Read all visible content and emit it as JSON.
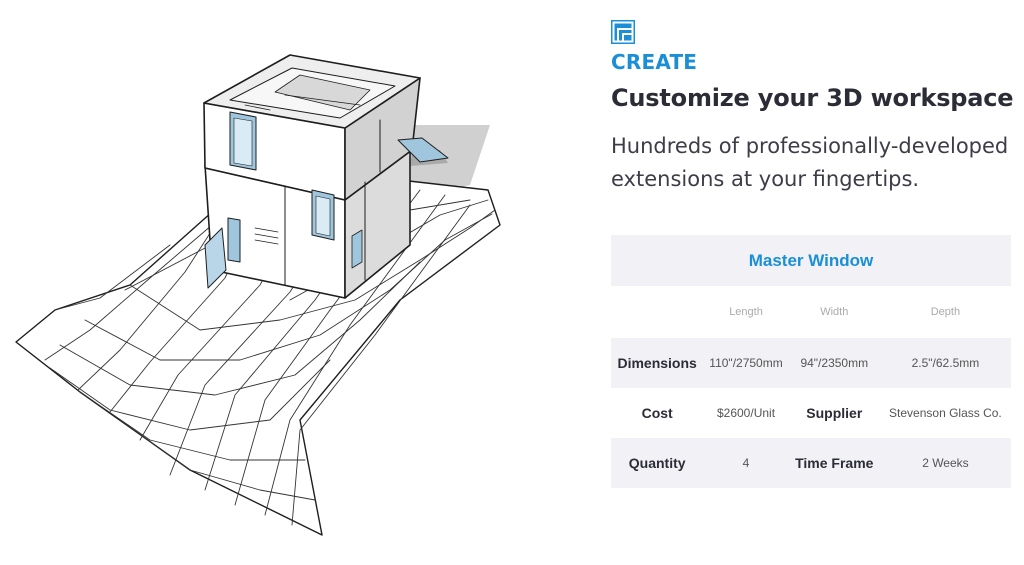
{
  "brand": {
    "accent_color": "#1a8fd8",
    "icon": "layers-icon"
  },
  "hero": {
    "eyebrow": "CREATE",
    "headline": "Customize your 3D workspace",
    "subtext": "Hundreds of professionally-developed extensions at your fingertips."
  },
  "spec_table": {
    "title": "Master Window",
    "headers": [
      "Length",
      "Width",
      "Depth"
    ],
    "rows": [
      {
        "label": "Dimensions",
        "length": "110\"/2750mm",
        "width": "94\"/2350mm",
        "depth": "2.5\"/62.5mm"
      },
      {
        "label": "Cost",
        "value": "$2600/Unit",
        "label2": "Supplier",
        "value2": "Stevenson Glass Co."
      },
      {
        "label": "Quantity",
        "value": "4",
        "label2": "Time Frame",
        "value2": "2 Weeks"
      }
    ]
  }
}
